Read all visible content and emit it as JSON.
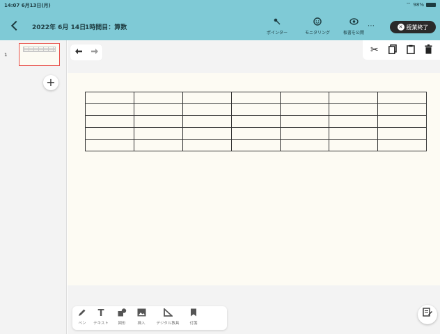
{
  "status": {
    "time": "14:07",
    "date": "6月13日(月)",
    "battery": "98%"
  },
  "header": {
    "title": "2022年 6月 14日",
    "subtitle": "1時間目：算数",
    "pointer_label": "ポインター",
    "monitoring_label": "モニタリング",
    "publish_label": "板書を公開",
    "more_label": "⋯",
    "end_label": "授業終了"
  },
  "sidebar": {
    "page_number": "1",
    "add_label": "+"
  },
  "canvas": {
    "rows": 5,
    "cols": 7
  },
  "toolbar": {
    "items": [
      {
        "label": "ペン",
        "icon": "pen-icon"
      },
      {
        "label": "テキスト",
        "icon": "text-icon"
      },
      {
        "label": "図形",
        "icon": "shape-icon"
      },
      {
        "label": "挿入",
        "icon": "image-icon"
      },
      {
        "label": "デジタル教具",
        "icon": "ruler-icon"
      },
      {
        "label": "付箋",
        "icon": "bookmark-icon"
      }
    ]
  },
  "colors": {
    "header_bg": "#7fcad6",
    "selected_page_border": "#e8504a",
    "canvas_bg": "#fdfbf3"
  }
}
